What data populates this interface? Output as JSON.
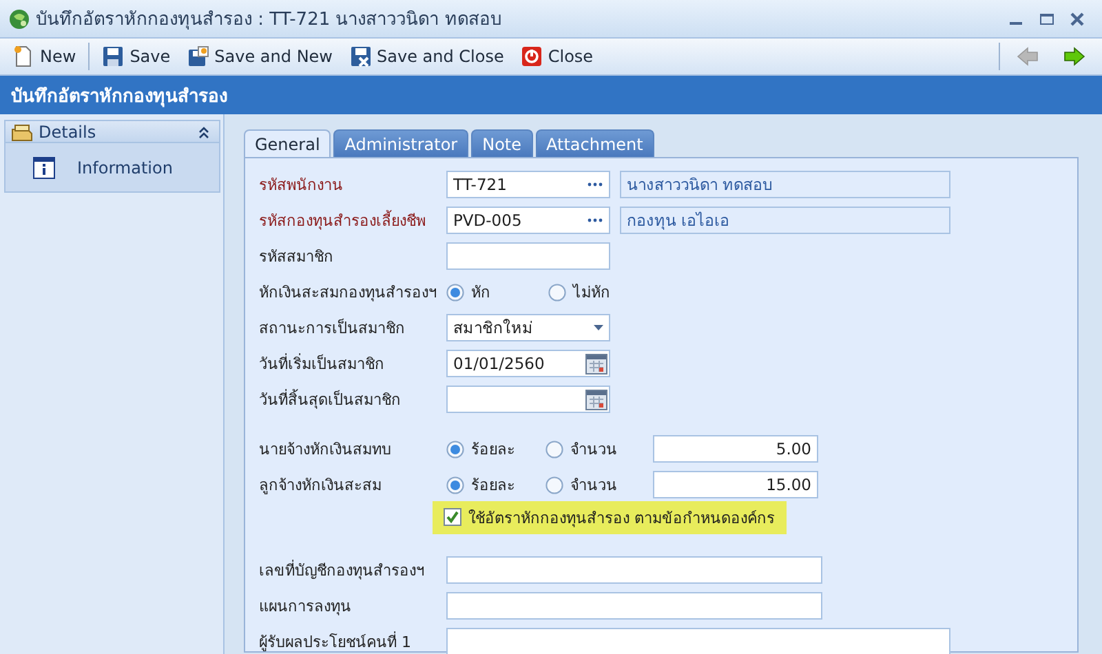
{
  "window": {
    "title": "บันทึกอัตราหักกองทุนสำรอง : TT-721 นางสาววนิดา ทดสอบ"
  },
  "toolbar": {
    "buttons": [
      {
        "kind": "new",
        "label": "New"
      },
      {
        "kind": "save",
        "label": "Save"
      },
      {
        "kind": "save_new",
        "label": "Save and New"
      },
      {
        "kind": "save_close",
        "label": "Save and Close"
      },
      {
        "kind": "close",
        "label": "Close"
      }
    ],
    "nav": [
      {
        "kind": "back",
        "disabled": true
      },
      {
        "kind": "forward",
        "disabled": false
      }
    ]
  },
  "header": "บันทึกอัตราหักกองทุนสำรอง",
  "sidebar": {
    "title": "Details",
    "expanded": true,
    "items": [
      {
        "label": "Information",
        "selected": false
      }
    ]
  },
  "tabs": [
    {
      "label": "General",
      "selected": true
    },
    {
      "label": "Administrator",
      "selected": false
    },
    {
      "label": "Note",
      "selected": false
    },
    {
      "label": "Attachment",
      "selected": false
    }
  ],
  "form": {
    "sections": [
      {
        "rows": [
          {
            "kind": "lookup",
            "label": "รหัสพนักงาน",
            "required": true,
            "value": "TT-721",
            "display": "นางสาววนิดา ทดสอบ"
          },
          {
            "kind": "lookup",
            "label": "รหัสกองทุนสำรองเลี้ยงชีพ",
            "required": true,
            "value": "PVD-005",
            "display": "กองทุน เอไอเอ"
          },
          {
            "kind": "text",
            "label": "รหัสสมาชิก",
            "required": false
          },
          {
            "kind": "radio",
            "label": "หักเงินสะสมกองทุนสำรองฯ",
            "required": false,
            "options": [
              {
                "label": "หัก",
                "selected": true
              },
              {
                "label": "ไม่หัก",
                "selected": false
              }
            ]
          },
          {
            "kind": "select",
            "label": "สถานะการเป็นสมาชิก",
            "required": false,
            "value": "สมาชิกใหม่"
          },
          {
            "kind": "date",
            "label": "วันที่เริ่มเป็นสมาชิก",
            "required": false,
            "value": "01/01/2560"
          },
          {
            "kind": "date",
            "label": "วันที่สิ้นสุดเป็นสมาชิก",
            "required": false
          }
        ]
      },
      {
        "rows": [
          {
            "kind": "rate",
            "label": "นายจ้างหักเงินสมทบ",
            "required": false,
            "options": [
              {
                "label": "ร้อยละ",
                "selected": true
              },
              {
                "label": "จำนวน",
                "selected": false
              }
            ],
            "value": "5.00"
          },
          {
            "kind": "rate",
            "label": "ลูกจ้างหักเงินสะสม",
            "required": false,
            "options": [
              {
                "label": "ร้อยละ",
                "selected": true
              },
              {
                "label": "จำนวน",
                "selected": false
              }
            ],
            "value": "15.00"
          },
          {
            "kind": "checkbox",
            "label": "ใช้อัตราหักกองทุนสำรอง ตามข้อกำหนดองค์กร",
            "checked": true,
            "highlighted": true
          }
        ]
      },
      {
        "rows": [
          {
            "kind": "long_text",
            "label": "เลขที่บัญชีกองทุนสำรองฯ",
            "required": false
          },
          {
            "kind": "long_text",
            "label": "แผนการลงทุน",
            "required": false
          },
          {
            "kind": "full_text",
            "label": "ผู้รับผลประโยชน์คนที่ 1",
            "required": false
          }
        ]
      }
    ]
  }
}
